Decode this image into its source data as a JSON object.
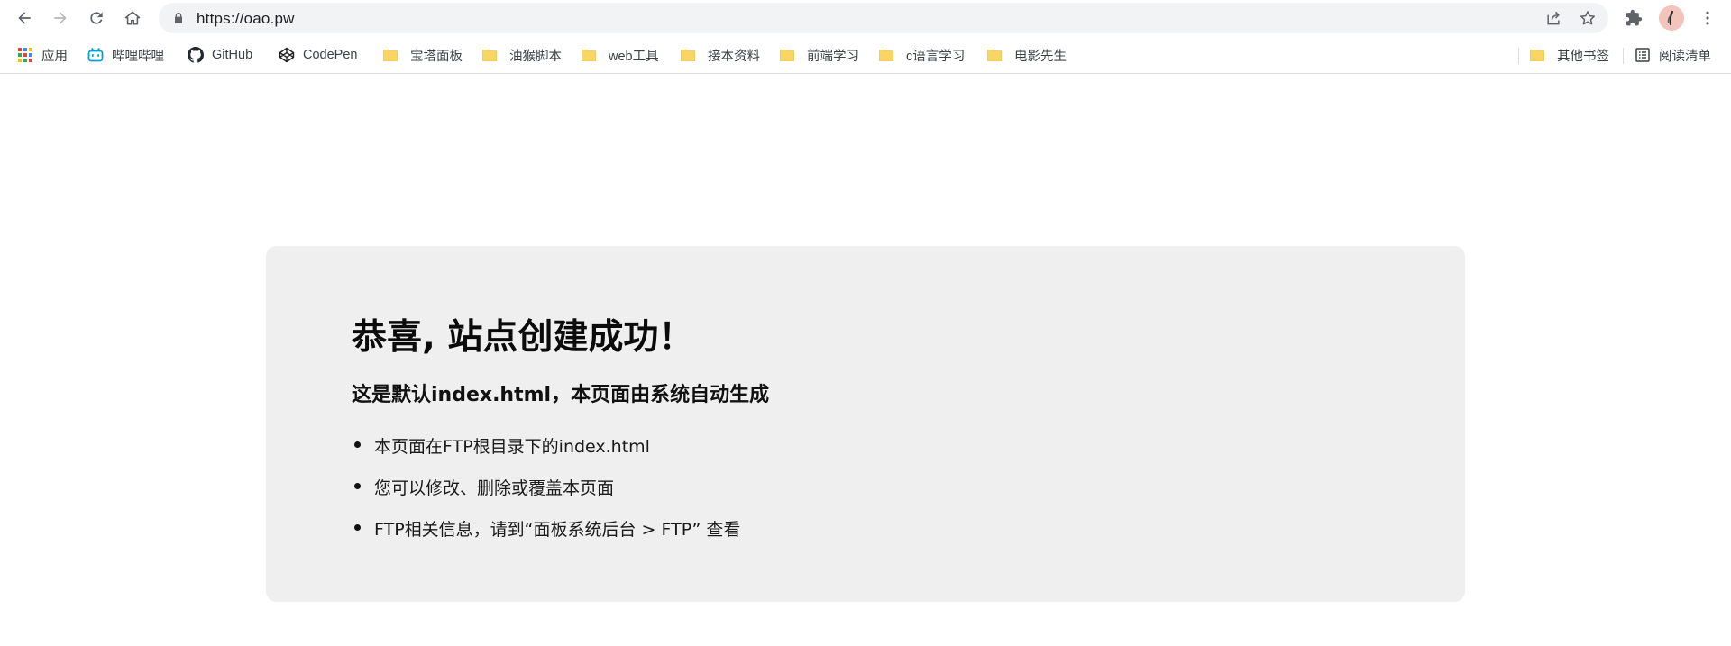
{
  "browser": {
    "url": "https://oao.pw",
    "nav": {
      "back_icon": "back-arrow-icon",
      "forward_icon": "forward-arrow-icon",
      "reload_icon": "reload-icon",
      "home_icon": "home-icon"
    },
    "omnibox_icons": [
      "lock-icon",
      "share-icon",
      "star-icon"
    ],
    "toolbar_icons": [
      "extensions-puzzle-icon",
      "avatar",
      "more-vert-icon"
    ]
  },
  "bookmarks": {
    "items": [
      {
        "label": "应用",
        "icon": "apps-grid-icon"
      },
      {
        "label": "哔哩哔哩",
        "icon": "bilibili-icon"
      },
      {
        "label": "GitHub",
        "icon": "github-icon"
      },
      {
        "label": "CodePen",
        "icon": "codepen-icon"
      },
      {
        "label": "宝塔面板",
        "icon": "folder-icon"
      },
      {
        "label": "油猴脚本",
        "icon": "folder-icon"
      },
      {
        "label": "web工具",
        "icon": "folder-icon"
      },
      {
        "label": "接本资料",
        "icon": "folder-icon"
      },
      {
        "label": "前端学习",
        "icon": "folder-icon"
      },
      {
        "label": "c语言学习",
        "icon": "folder-icon"
      },
      {
        "label": "电影先生",
        "icon": "folder-icon"
      }
    ],
    "other": {
      "label": "其他书签",
      "icon": "folder-icon"
    },
    "reading_list": {
      "label": "阅读清单",
      "icon": "reading-list-icon"
    }
  },
  "page": {
    "title": "恭喜, 站点创建成功！",
    "subtitle": "这是默认index.html，本页面由系统自动生成",
    "items": [
      "本页面在FTP根目录下的index.html",
      "您可以修改、删除或覆盖本页面",
      "FTP相关信息，请到“面板系统后台 > FTP” 查看"
    ]
  },
  "colors": {
    "card_bg": "#efefef",
    "folder": "#f9d565",
    "bilibili": "#00a1d6"
  }
}
